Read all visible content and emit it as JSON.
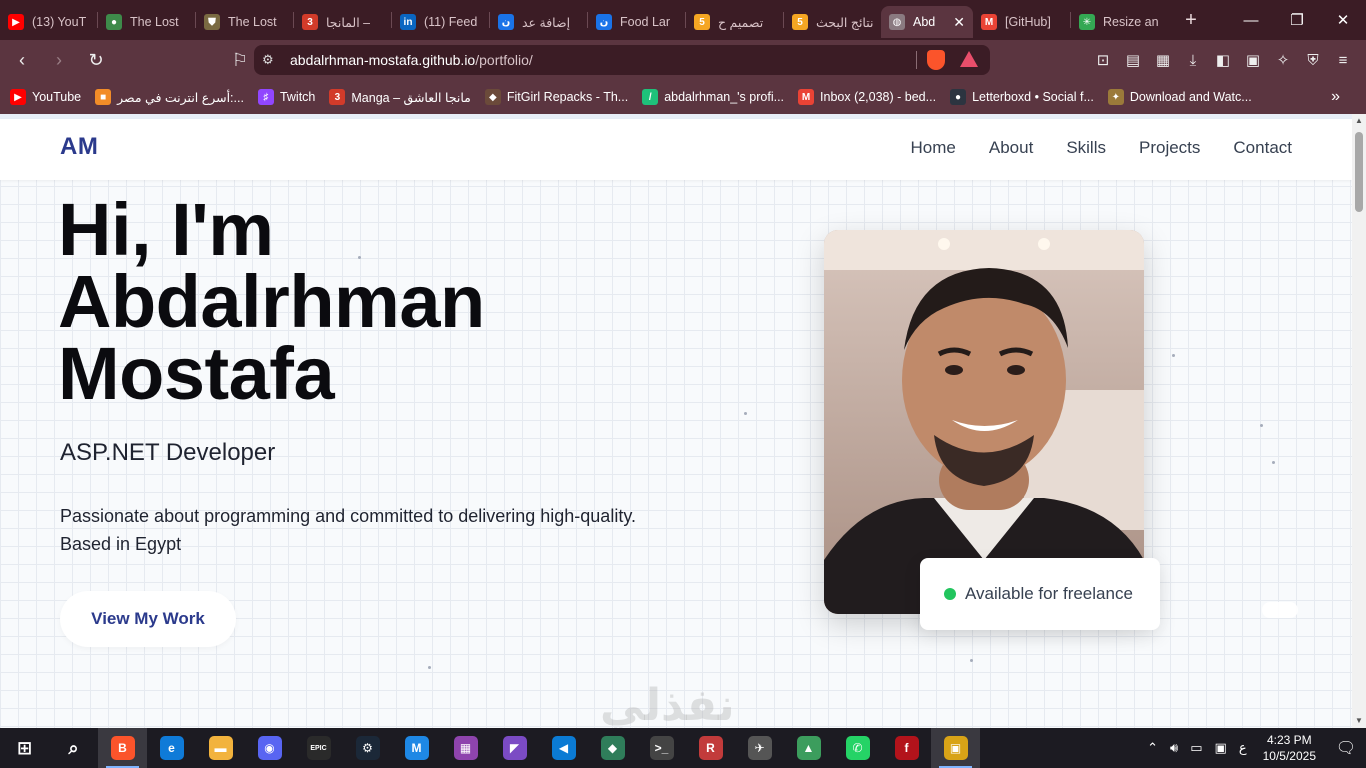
{
  "browser": {
    "tabs": [
      {
        "title": "(13) YouT",
        "icon": "youtube-icon",
        "color": "#ff0000",
        "glyph": "▶"
      },
      {
        "title": "The Lost",
        "icon": "chrome-icon",
        "color": "#3e8a4a",
        "glyph": "●"
      },
      {
        "title": "The Lost",
        "icon": "spartan-icon",
        "color": "#7a6a42",
        "glyph": "⛊"
      },
      {
        "title": "المانجا –",
        "icon": "manga-icon",
        "color": "#d23b2a",
        "glyph": "3"
      },
      {
        "title": "(11) Feed",
        "icon": "linkedin-icon",
        "color": "#0a66c2",
        "glyph": "in"
      },
      {
        "title": "إضافة عد",
        "icon": "app-icon",
        "color": "#1a73e8",
        "glyph": "ن"
      },
      {
        "title": "Food Lar",
        "icon": "app-icon-2",
        "color": "#1a73e8",
        "glyph": "ن"
      },
      {
        "title": "تصميم ح",
        "icon": "number5-icon",
        "color": "#f5a623",
        "glyph": "5"
      },
      {
        "title": "نتائج البحث",
        "icon": "number5-icon-2",
        "color": "#f5a623",
        "glyph": "5"
      },
      {
        "title": "Abd",
        "icon": "globe-icon",
        "color": "#8a7a80",
        "glyph": "◍",
        "active": true
      },
      {
        "title": "[GitHub]",
        "icon": "gmail-icon",
        "color": "#ea4335",
        "glyph": "M"
      },
      {
        "title": "Resize an",
        "icon": "pinwheel-icon",
        "color": "#34a853",
        "glyph": "✳"
      }
    ],
    "url_host": "abdalrhman-mostafa.github.io",
    "url_path": "/portfolio/",
    "bookmarks": [
      {
        "label": "YouTube",
        "color": "#ff0000",
        "glyph": "▶"
      },
      {
        "label": "أسرع انترنت في مصر:...",
        "color": "#f28c28",
        "glyph": "■"
      },
      {
        "label": "Twitch",
        "color": "#9146ff",
        "glyph": "♯"
      },
      {
        "label": "Manga – مانجا العاشق",
        "color": "#d23b2a",
        "glyph": "3"
      },
      {
        "label": "FitGirl Repacks - Th...",
        "color": "#6b4a3a",
        "glyph": "◆"
      },
      {
        "label": "abdalrhman_'s profi...",
        "color": "#1ec17a",
        "glyph": "/"
      },
      {
        "label": "Inbox (2,038) - bed...",
        "color": "#ea4335",
        "glyph": "M"
      },
      {
        "label": "Letterboxd • Social f...",
        "color": "#2c3440",
        "glyph": "●"
      },
      {
        "label": "Download and Watc...",
        "color": "#9b7a3a",
        "glyph": "✦"
      }
    ]
  },
  "site": {
    "logo": "AM",
    "nav": [
      "Home",
      "About",
      "Skills",
      "Projects",
      "Contact"
    ],
    "hero_line1": "Hi, I'm",
    "hero_line2": "Abdalrhman",
    "hero_line3": "Mostafa",
    "role": "ASP.NET Developer",
    "description": "Passionate about programming and committed to delivering high-quality. Based in Egypt",
    "cta": "View My Work",
    "badge": "Available for freelance",
    "watermark": "نفذلي"
  },
  "taskbar": {
    "time": "4:23 PM",
    "date": "10/5/2025",
    "lang": "ع",
    "apps": [
      {
        "name": "brave-app",
        "color": "#fb542b",
        "glyph": "B",
        "active": true
      },
      {
        "name": "edge-app",
        "color": "#0f7bd8",
        "glyph": "e"
      },
      {
        "name": "file-explorer-app",
        "color": "#f2b33d",
        "glyph": "▬"
      },
      {
        "name": "discord-app",
        "color": "#5865f2",
        "glyph": "◉"
      },
      {
        "name": "epic-games-app",
        "color": "#2a2a2a",
        "glyph": "EPIC"
      },
      {
        "name": "steam-app",
        "color": "#1b2838",
        "glyph": "⚙"
      },
      {
        "name": "mega-app",
        "color": "#1e88e5",
        "glyph": "M"
      },
      {
        "name": "winrar-app",
        "color": "#8e44ad",
        "glyph": "▦"
      },
      {
        "name": "visual-studio-app",
        "color": "#7b4bc4",
        "glyph": "◤"
      },
      {
        "name": "vscode-app",
        "color": "#0b7bd4",
        "glyph": "◀"
      },
      {
        "name": "app-generic-1",
        "color": "#2f7d5a",
        "glyph": "◆"
      },
      {
        "name": "terminal-app",
        "color": "#444",
        "glyph": ">_"
      },
      {
        "name": "app-generic-2",
        "color": "#c23b3b",
        "glyph": "R"
      },
      {
        "name": "app-generic-3",
        "color": "#555",
        "glyph": "✈"
      },
      {
        "name": "app-generic-4",
        "color": "#3c9d5d",
        "glyph": "▲"
      },
      {
        "name": "whatsapp-app",
        "color": "#25d366",
        "glyph": "✆"
      },
      {
        "name": "app-generic-5",
        "color": "#b3131b",
        "glyph": "f"
      },
      {
        "name": "app-generic-6",
        "color": "#d8a317",
        "glyph": "▣",
        "active": true
      }
    ]
  }
}
